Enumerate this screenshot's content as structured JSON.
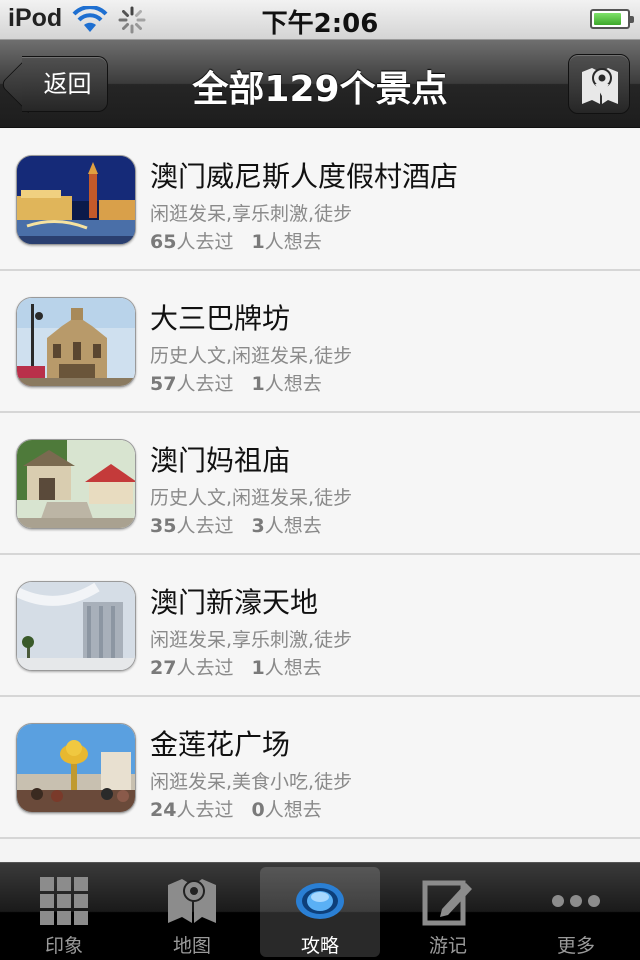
{
  "status_bar": {
    "carrier": "iPod",
    "time": "下午2:06",
    "battery_level": 0.85
  },
  "nav_bar": {
    "back_label": "返回",
    "title": "全部129个景点",
    "map_button_icon": "map-pin-icon"
  },
  "places": [
    {
      "name": "澳门威尼斯人度假村酒店",
      "tags": "闲逛发呆,享乐刺激,徒步",
      "visited_count": "65",
      "visited_label": "人去过",
      "want_count": "1",
      "want_label": "人想去"
    },
    {
      "name": "大三巴牌坊",
      "tags": "历史人文,闲逛发呆,徒步",
      "visited_count": "57",
      "visited_label": "人去过",
      "want_count": "1",
      "want_label": "人想去"
    },
    {
      "name": "澳门妈祖庙",
      "tags": "历史人文,闲逛发呆,徒步",
      "visited_count": "35",
      "visited_label": "人去过",
      "want_count": "3",
      "want_label": "人想去"
    },
    {
      "name": "澳门新濠天地",
      "tags": "闲逛发呆,享乐刺激,徒步",
      "visited_count": "27",
      "visited_label": "人去过",
      "want_count": "1",
      "want_label": "人想去"
    },
    {
      "name": "金莲花广场",
      "tags": "闲逛发呆,美食小吃,徒步",
      "visited_count": "24",
      "visited_label": "人去过",
      "want_count": "0",
      "want_label": "人想去"
    }
  ],
  "tab_bar": {
    "tabs": [
      {
        "label": "印象",
        "icon": "grid-icon"
      },
      {
        "label": "地图",
        "icon": "map-icon"
      },
      {
        "label": "攻略",
        "icon": "eye-icon"
      },
      {
        "label": "游记",
        "icon": "edit-icon"
      },
      {
        "label": "更多",
        "icon": "more-icon"
      }
    ],
    "active_index": 2
  },
  "colors": {
    "active_tab_icon": "#2a7fd4",
    "nav_bar": "#2b2b2b",
    "tag_text": "#8a8a8a"
  }
}
